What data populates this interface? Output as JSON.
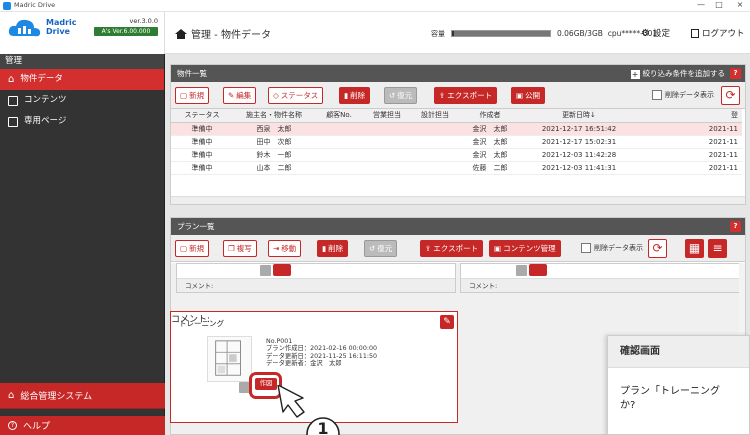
{
  "window": {
    "title": "Madric Drive",
    "min": "—",
    "max": "□",
    "close": "×"
  },
  "brand": {
    "name_line1": "Madric",
    "name_line2": "Drive",
    "version": "ver.3.0.0",
    "build": "A's Ver.6.00.000"
  },
  "sidebar": {
    "section": "管理",
    "items": [
      {
        "label": "物件データ",
        "icon": "home-icon",
        "active": true
      },
      {
        "label": "コンテンツ",
        "icon": "image-icon",
        "active": false
      },
      {
        "label": "専用ページ",
        "icon": "page-icon",
        "active": false
      }
    ],
    "bottom": [
      {
        "label": "総合管理システム",
        "icon": "system-icon"
      },
      {
        "label": "ヘルプ",
        "icon": "help-icon"
      }
    ]
  },
  "header": {
    "breadcrumb": "管理 - 物件データ",
    "capacity_label": "容量",
    "capacity_value": "0.06GB/3GB",
    "capacity_pct": 2,
    "cpu": "cpu*****-001",
    "settings": "設定",
    "logout": "ログアウト"
  },
  "property_panel": {
    "title": "物件一覧",
    "filter_label": "絞り込み条件を追加する",
    "help": "?",
    "toolbar": {
      "new": "新規",
      "edit": "編集",
      "status": "ステータス",
      "delete": "削除",
      "restore": "復元",
      "export": "エクスポート",
      "publish": "公開",
      "show_deleted": "削除データ表示"
    },
    "columns": [
      "ステータス",
      "施主名・物件名称",
      "顧客No.",
      "営業担当",
      "設計担当",
      "作成者",
      "更新日時↓",
      "登"
    ],
    "rows": [
      {
        "status": "準備中",
        "name": "西泉　太郎",
        "customer": "",
        "sales": "",
        "design": "",
        "author": "金沢　太郎",
        "updated": "2021-12-17 16:51:42",
        "reg": "2021-11",
        "selected": true
      },
      {
        "status": "準備中",
        "name": "田中　次郎",
        "customer": "",
        "sales": "",
        "design": "",
        "author": "金沢　太郎",
        "updated": "2021-12-17 15:02:31",
        "reg": "2021-11",
        "selected": false
      },
      {
        "status": "準備中",
        "name": "鈴木　一郎",
        "customer": "",
        "sales": "",
        "design": "",
        "author": "金沢　太郎",
        "updated": "2021-12-03 11:42:28",
        "reg": "2021-11",
        "selected": false
      },
      {
        "status": "準備中",
        "name": "山本　二郎",
        "customer": "",
        "sales": "",
        "design": "",
        "author": "佐藤　二郎",
        "updated": "2021-12-03 11:41:31",
        "reg": "2021-11",
        "selected": false
      }
    ]
  },
  "plan_panel": {
    "title": "プラン一覧",
    "help": "?",
    "toolbar": {
      "new": "新規",
      "copy": "複写",
      "move": "移動",
      "delete": "削除",
      "restore": "復元",
      "export": "エクスポート",
      "content_manage": "コンテンツ管理",
      "show_deleted": "削除データ表示"
    },
    "comment_label": "コメント:",
    "card": {
      "title": "トレーニング",
      "no": "No.P001",
      "created": "プラン作成日：2021-02-16 00:00:00",
      "updated": "データ更新日：2021-11-25 16:11:50",
      "updater": "データ更新者：金沢　太郎",
      "create_btn": "作図"
    },
    "prev_create_btn": "作図"
  },
  "modal": {
    "title": "確認画面",
    "message_line1": "プラン「トレーニング",
    "message_line2": "か?"
  },
  "callout": {
    "number": "1"
  },
  "colors": {
    "accent": "#c62828",
    "header_bar": "#555555",
    "sidebar": "#333333"
  }
}
